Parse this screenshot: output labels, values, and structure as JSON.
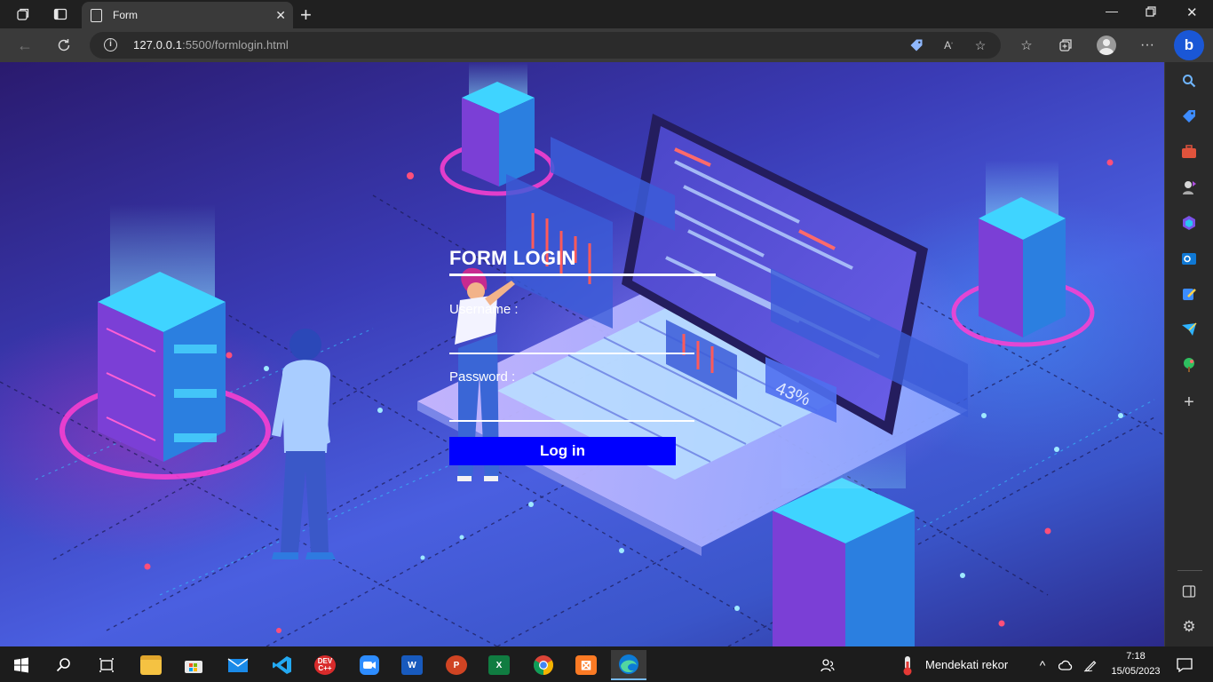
{
  "browser": {
    "tab": {
      "title": "Form"
    },
    "address": {
      "host": "127.0.0.1",
      "rest": ":5500/formlogin.html"
    }
  },
  "form": {
    "title": "FORM LOGIN",
    "username_label": "Username :",
    "password_label": "Password :",
    "username_value": "",
    "password_value": "",
    "login_label": "Log in",
    "button_color": "#0000ff"
  },
  "illustration": {
    "badge_text": "43%"
  },
  "taskbar": {
    "weather_text": "Mendekati rekor",
    "time": "7:18",
    "date": "15/05/2023",
    "apps": [
      "start",
      "search",
      "task-view",
      "file-explorer",
      "microsoft-store",
      "mail",
      "vscode",
      "dev-cpp",
      "zoom",
      "word",
      "powerpoint",
      "excel",
      "chrome",
      "xampp",
      "edge"
    ]
  }
}
